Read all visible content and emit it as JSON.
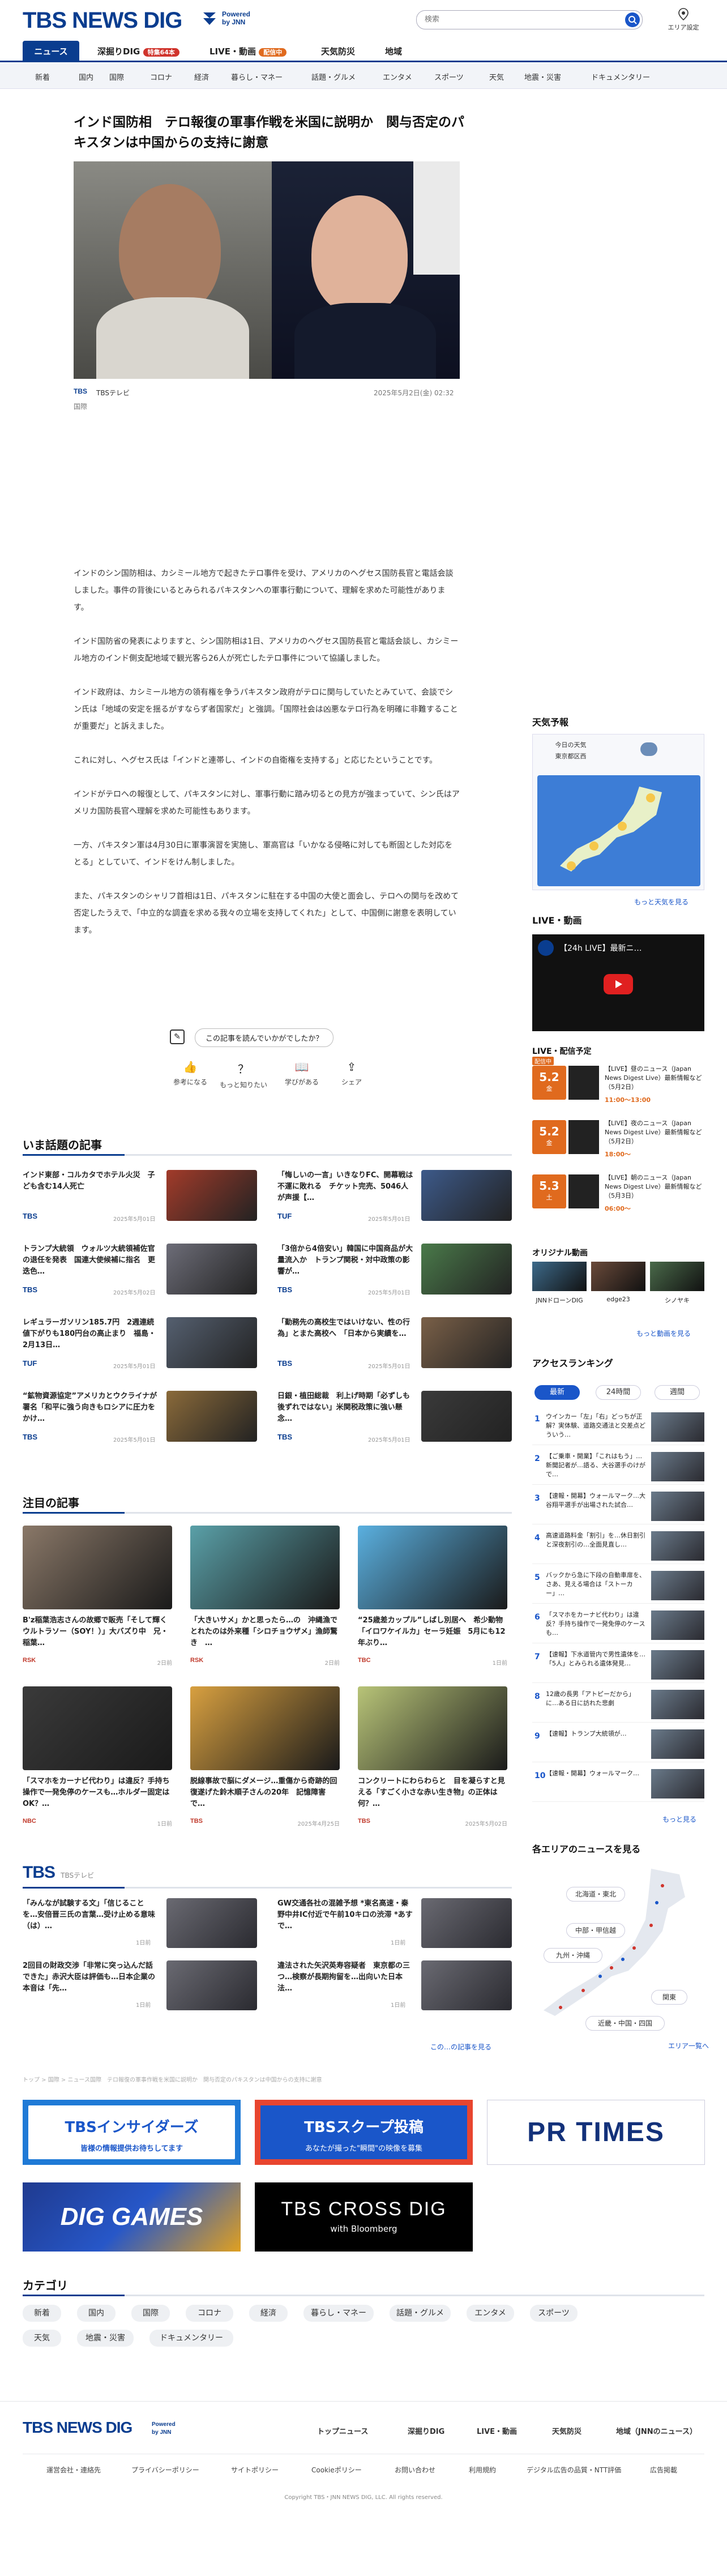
{
  "header": {
    "logo": "TBS NEWS DIG",
    "powered_line1": "Powered",
    "powered_line2": "by JNN",
    "search_placeholder": "検索",
    "area_setting": "エリア設定"
  },
  "tabs": [
    {
      "label": "ニュース"
    },
    {
      "label": "深掘りDIG",
      "badge": "特集64本"
    },
    {
      "label": "LIVE・動画",
      "badge": "配信中"
    },
    {
      "label": "天気防災"
    },
    {
      "label": "地域"
    }
  ],
  "categories_nav": [
    "新着",
    "国内",
    "国際",
    "コロナ",
    "経済",
    "暮らし・マネー",
    "話題・グルメ",
    "エンタメ",
    "スポーツ",
    "天気",
    "地震・災害",
    "ドキュメンタリー"
  ],
  "article": {
    "headline": "インド国防相　テロ報復の軍事作戦を米国に説明か　関与否定のパキスタンは中国からの支持に謝意",
    "source": "TBSテレビ",
    "date": "2025年5月2日(金) 02:32",
    "category": "国際",
    "paragraphs": [
      "インドのシン国防相は、カシミール地方で起きたテロ事件を受け、アメリカのヘグセス国防長官と電話会談しました。事件の背後にいるとみられるパキスタンへの軍事行動について、理解を求めた可能性があります。",
      "インド国防省の発表によりますと、シン国防相は1日、アメリカのヘグセス国防長官と電話会談し、カシミール地方のインド側支配地域で観光客ら26人が死亡したテロ事件について協議しました。",
      "インド政府は、カシミール地方の領有権を争うパキスタン政府がテロに関与していたとみていて、会談でシン氏は「地域の安定を揺るがすならず者国家だ」と強調。「国際社会は凶悪なテロ行為を明確に非難することが重要だ」と訴えました。",
      "これに対し、ヘグセス氏は「インドと連帯し、インドの自衛権を支持する」と応じたということです。",
      "インドがテロへの報復として、パキスタンに対し、軍事行動に踏み切るとの見方が強まっていて、シン氏はアメリカ国防長官へ理解を求めた可能性もあります。",
      "一方、パキスタン軍は4月30日に軍事演習を実施し、軍高官は「いかなる侵略に対しても断固とした対応をとる」としていて、インドをけん制しました。",
      "また、パキスタンのシャリフ首相は1日、パキスタンに駐在する中国の大使と面会し、テロへの関与を改めて否定したうえで、「中立的な調査を求める我々の立場を支持してくれた」として、中国側に謝意を表明しています。"
    ],
    "feedback_question": "この記事を読んでいかがでしたか？",
    "reactions": [
      "参考になる",
      "もっと知りたい",
      "学びがある",
      "シェア"
    ]
  },
  "trending": {
    "title": "いま話題の記事",
    "items": [
      {
        "title": "インド東部・コルカタでホテル火災　子ども含む14人死亡",
        "source": "TBS",
        "date": "2025年5月01日"
      },
      {
        "title": "「悔しいの一言」いきなりFC、開幕戦は不運に敗れる　チケット完売、5046人が声援【…",
        "source": "TUF",
        "date": "2025年5月01日"
      },
      {
        "title": "トランプ大統領　ウォルツ大統領補佐官の退任を発表　国連大使候補に指名　更迭色…",
        "source": "TBS",
        "date": "2025年5月02日"
      },
      {
        "title": "「3倍から4倍安い」韓国に中国商品が大量流入か　トランプ関税・対中政策の影響が…",
        "source": "TBS",
        "date": "2025年5月01日"
      },
      {
        "title": "レギュラーガソリン185.7円　2週連続値下がりも180円台の高止まり　福島・2月13日…",
        "source": "TUF",
        "date": "2025年5月01日"
      },
      {
        "title": "「勤務先の高校生ではいけない、性の行為」とまた高校へ　「日本から実績を…",
        "source": "TBS",
        "date": "2025年5月01日"
      },
      {
        "title": "“鉱物資源協定”アメリカとウクライナが署名「和平に強う向きもロシアに圧力をかけ…",
        "source": "TBS",
        "date": "2025年5月01日"
      },
      {
        "title": "日銀・植田総裁　利上げ時期「必ずしも後ずれではない」米関税政策に強い懸念…",
        "source": "TBS",
        "date": "2025年5月01日"
      }
    ]
  },
  "featured": {
    "title": "注目の記事",
    "items": [
      {
        "title": "B'z稲葉浩志さんの故郷で販売「そして輝くウルトラソー（SOY！）」大バズり中　兄・稲葉…",
        "source": "RSK",
        "date": "2日前"
      },
      {
        "title": "「大きいサメ」かと思ったら…の　沖縄漁でとれたのは外来種「シロチョウザメ」漁師驚き　…",
        "source": "RSK",
        "date": "2日前"
      },
      {
        "title": "“25歳差カップル”しばし別居へ　希少動物「イロワケイルカ」セーラ妊娠　5月にも12年ぶり…",
        "source": "TBC",
        "date": "1日前"
      },
      {
        "title": "「スマホをカーナビ代わり」は違反？手持ち操作で一発免停のケースも…ホルダー固定はOK？…",
        "source": "NBC",
        "date": "1日前"
      },
      {
        "title": "脱線事故で脳にダメージ…重傷から奇跡的回復遂げた鈴木順子さんの20年　記憶障害で…",
        "source": "TBS",
        "date": "2025年4月25日"
      },
      {
        "title": "コンクリートにわらわらと　目を凝らすと見える「すごく小さな赤い生き物」の正体は何？…",
        "source": "TBS",
        "date": "2025年5月02日"
      }
    ]
  },
  "tbs_section": {
    "title": "TBS",
    "sub": "TBSテレビ",
    "items": [
      {
        "title": "「みんなが試験する文」「信じることを…安倍晋三氏の言葉…受け止める意味（は）…",
        "date": "1日前"
      },
      {
        "title": "GW交通各社の混雑予想 *東名高速・秦野中井IC付近で午前10キロの渋滞 *あすで…",
        "date": "1日前"
      },
      {
        "title": "2回目の財政交渉「非常に突っ込んだ話できた」赤沢大臣は評価も…日本企業の本音は「先…",
        "date": "1日前"
      },
      {
        "title": "違法された矢沢英寿容疑者　東京都の三つ…検察が長期拘留を…出向いた日本法…",
        "date": "1日前"
      }
    ],
    "more": "この…の記事を見る"
  },
  "breadcrumb": "トップ > 国際 > ニュース国際　テロ報復の軍事作戦を米国に説明か　関与否定のパキスタンは中国からの支持に謝意",
  "banners": [
    {
      "title": "TBSインサイダーズ",
      "sub": "皆様の情報提供お待ちしてます"
    },
    {
      "title": "TBSスクープ投稿",
      "sub": "あなたが撮った\"瞬間\"の映像を募集"
    },
    {
      "title": "PR TIMES"
    },
    {
      "title": "DIG GAMES"
    },
    {
      "title": "TBS CROSS DIG",
      "sub": "with Bloomberg"
    }
  ],
  "category_section": {
    "title": "カテゴリ",
    "items": [
      "新着",
      "国内",
      "国際",
      "コロナ",
      "経済",
      "暮らし・マネー",
      "話題・グルメ",
      "エンタメ",
      "スポーツ",
      "天気",
      "地震・災害",
      "ドキュメンタリー"
    ]
  },
  "sidebar": {
    "weather": {
      "title": "天気予報",
      "today": "今日の天気",
      "area": "東京都区西",
      "more": "もっと天気を見る"
    },
    "live": {
      "title": "LIVE・動画",
      "video_title": "【24h LIVE】最新ニ…"
    },
    "schedule": {
      "title": "LIVE・配信予定",
      "items": [
        {
          "date": "5.2",
          "day": "金",
          "title": "【LIVE】昼のニュース（Japan News Digest Live）最新情報など（5月2日）",
          "time": "11:00〜13:00",
          "tag": "配信中"
        },
        {
          "date": "5.2",
          "day": "金",
          "title": "【LIVE】夜のニュース（Japan News Digest Live）最新情報など（5月2日）",
          "time": "18:00〜",
          "tag": ""
        },
        {
          "date": "5.3",
          "day": "土",
          "title": "【LIVE】朝のニュース（Japan News Digest Live）最新情報など（5月3日）",
          "time": "06:00〜",
          "tag": ""
        }
      ]
    },
    "original": {
      "title": "オリジナル動画",
      "items": [
        "JNNドローンDIG",
        "edge23",
        "シノヤキ"
      ],
      "more": "もっと動画を見る"
    },
    "ranking": {
      "title": "アクセスランキング",
      "tabs": [
        "最新",
        "24時間",
        "週間"
      ],
      "items": [
        "ウインカー「左」「右」どっちが正解？実体験、道路交通法と交差点どういう…",
        "【ご乗車・開業】「これはもう」…新聞記者が…語る、大谷選手のけがで…",
        "【速報・開幕】ウォールマーク…大谷翔平選手が出場された試合…",
        "高速道路料金「割引」を…休日割引と深夜割引の…全面見直し…",
        "バックから急に下段の自動車扉を、さあ、見える場合は「ストーカー」…",
        "「スマホをカーナビ代わり」は違反？手持ち操作で一発免停のケースも…",
        "【速報】下水道管内で男性遺体を…「5人」とみられる遺体発見…",
        "12歳の長男「アトピーだから」に…ある日に訪れた悲劇",
        "【速報】トランプ大統領が…",
        "【速報・開幕】ウォールマーク…"
      ],
      "more": "もっと見る"
    },
    "area": {
      "title": "各エリアのニュースを見る",
      "regions": [
        "北海道・東北",
        "中部・甲信越",
        "九州・沖縄",
        "関東",
        "近畿・中国・四国"
      ],
      "more": "エリア一覧へ"
    }
  },
  "footer": {
    "logo": "TBS NEWS DIG",
    "links": [
      "トップニュース",
      "深掘りDIG",
      "LIVE・動画",
      "天気防災",
      "地域（JNNのニュース）"
    ],
    "small_links": [
      "運営会社・連絡先",
      "プライバシーポリシー",
      "サイトポリシー",
      "Cookieポリシー",
      "お問い合わせ",
      "利用規約",
      "デジタル広告の品質・NTT評価",
      "広告掲載"
    ],
    "copyright": "Copyright TBS・JNN NEWS DIG, LLC. All rights reserved."
  },
  "colors": {
    "brand": "#0a3d8f",
    "accent": "#1a56c9",
    "live": "#e06a1e"
  }
}
